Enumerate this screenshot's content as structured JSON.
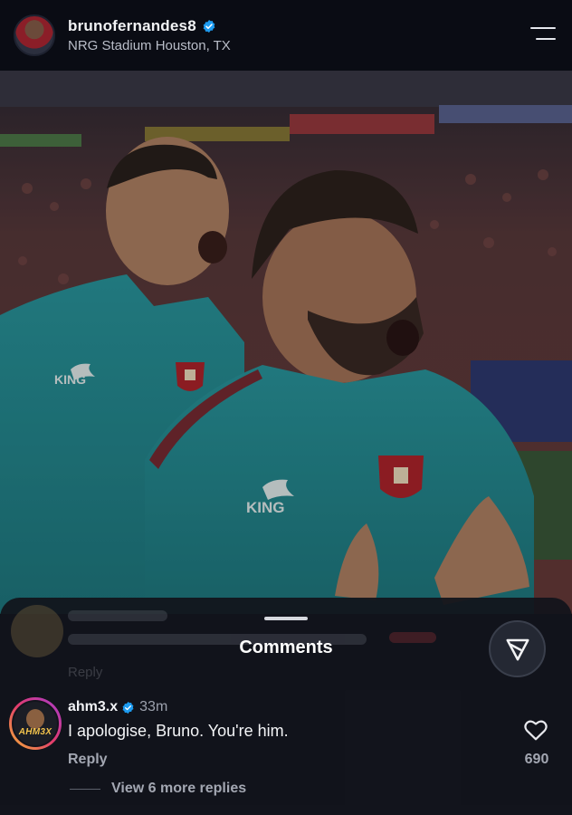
{
  "header": {
    "username": "brunofernandes8",
    "location": "NRG Stadium Houston, TX",
    "verified": true
  },
  "photo": {
    "jacket_brand": "KING"
  },
  "ghost_comment": {
    "reply_label": "Reply"
  },
  "comments_sheet": {
    "title": "Comments",
    "comment": {
      "username": "ahm3.x",
      "verified": true,
      "time": "33m",
      "text": "I apologise, Bruno. You're him.",
      "reply_label": "Reply",
      "likes": "690",
      "avatar_tag": "AHM3X"
    },
    "view_more_replies": "View 6 more replies"
  },
  "colors": {
    "verified_blue": "#1d9bf0",
    "jacket_teal": "#2a8f96",
    "background": "#0b0d14"
  },
  "icons": [
    "verified-badge-icon",
    "menu-icon",
    "share-icon",
    "heart-icon"
  ]
}
